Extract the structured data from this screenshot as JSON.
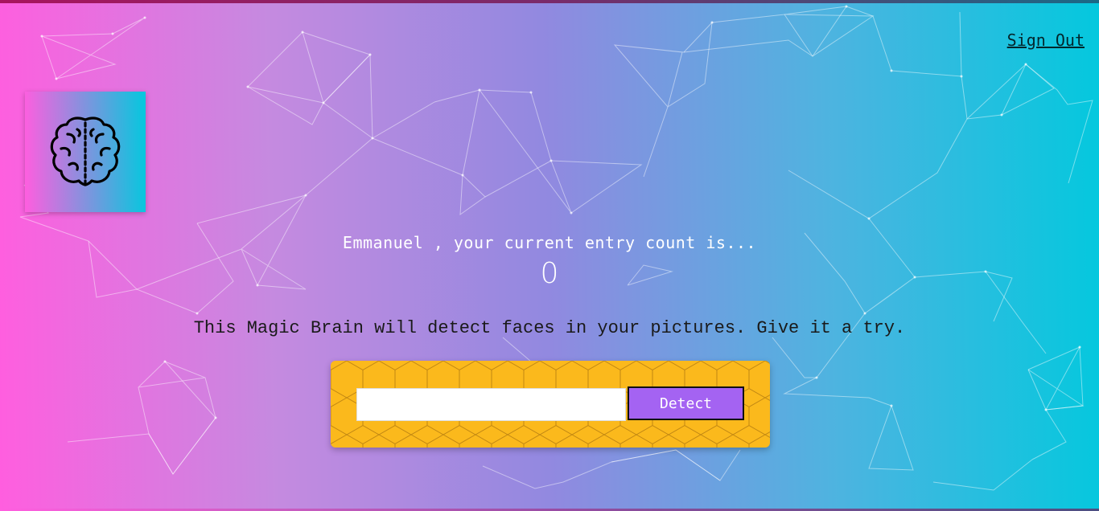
{
  "header": {
    "sign_out_label": "Sign Out"
  },
  "logo": {
    "icon": "brain-icon"
  },
  "rank": {
    "greeting": "Emmanuel , your current entry count is...",
    "count": "0"
  },
  "image_link_form": {
    "instructions": "This Magic Brain will detect faces in your pictures. Give it a try.",
    "input_value": "",
    "input_placeholder": "",
    "detect_label": "Detect"
  },
  "colors": {
    "gradient_start": "#ff5edf",
    "gradient_end": "#04c8de",
    "panel": "#fbb91c",
    "button": "#a463f2"
  }
}
